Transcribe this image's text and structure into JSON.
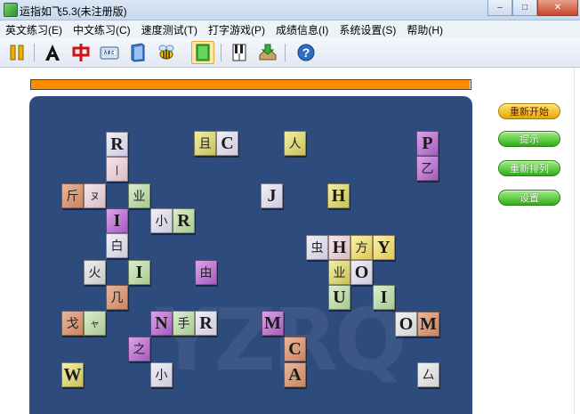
{
  "window": {
    "title": "运指如飞5.3(未注册版)",
    "minimize_symbol": "–",
    "maximize_symbol": "□",
    "close_symbol": "✕"
  },
  "menu": [
    "英文练习(E)",
    "中文练习(C)",
    "速度测试(T)",
    "打字游戏(P)",
    "成绩信息(I)",
    "系统设置(S)",
    "帮助(H)"
  ],
  "toolbar": {
    "icons": [
      "pause-icon",
      "english-letter-icon",
      "chinese-char-icon",
      "abc-keyboard-icon",
      "book-icon",
      "game-bee-icon",
      "green-book-icon",
      "piano-keys-icon",
      "download-tray-icon",
      "help-icon"
    ],
    "active_icon": "green-book-icon",
    "help_label": "?"
  },
  "progress": {
    "fraction": 0.998,
    "color": "#ff8c00"
  },
  "game": {
    "watermark": "YZRQ",
    "tiles": [
      {
        "ch": "R",
        "kind": "latin",
        "color": "lav"
      },
      {
        "ch": "|",
        "kind": "cjk",
        "color": "lpink"
      },
      {
        "ch": "且",
        "kind": "cjk",
        "color": "olive"
      },
      {
        "ch": "C",
        "kind": "latin",
        "color": "lav"
      },
      {
        "ch": "人",
        "kind": "cjk",
        "color": "olive"
      },
      {
        "ch": "P",
        "kind": "latin",
        "color": "purple"
      },
      {
        "ch": "乙",
        "kind": "cjk",
        "color": "purple"
      },
      {
        "ch": "斤",
        "kind": "cjk",
        "color": "salmon"
      },
      {
        "ch": "ヌ",
        "kind": "cjk",
        "color": "lpink"
      },
      {
        "ch": "业",
        "kind": "cjk",
        "color": "lgreen"
      },
      {
        "ch": "J",
        "kind": "latin",
        "color": "lav"
      },
      {
        "ch": "H",
        "kind": "latin",
        "color": "olive"
      },
      {
        "ch": "I",
        "kind": "latin",
        "color": "purple"
      },
      {
        "ch": "小",
        "kind": "cjk",
        "color": "lav"
      },
      {
        "ch": "R",
        "kind": "latin",
        "color": "lgreen"
      },
      {
        "ch": "白",
        "kind": "cjk",
        "color": "lav"
      },
      {
        "ch": "虫",
        "kind": "cjk",
        "color": "lav"
      },
      {
        "ch": "H",
        "kind": "latin",
        "color": "lpink"
      },
      {
        "ch": "方",
        "kind": "cjk",
        "color": "yellow"
      },
      {
        "ch": "Y",
        "kind": "latin",
        "color": "yellow"
      },
      {
        "ch": "火",
        "kind": "cjk",
        "color": "grey"
      },
      {
        "ch": "I",
        "kind": "latin",
        "color": "lgreen"
      },
      {
        "ch": "由",
        "kind": "cjk",
        "color": "purple"
      },
      {
        "ch": "业",
        "kind": "cjk",
        "color": "olive"
      },
      {
        "ch": "O",
        "kind": "latin",
        "color": "lav"
      },
      {
        "ch": "U",
        "kind": "latin",
        "color": "lgreen"
      },
      {
        "ch": "I",
        "kind": "latin",
        "color": "lgreen"
      },
      {
        "ch": "几",
        "kind": "cjk",
        "color": "salmon"
      },
      {
        "ch": "戈",
        "kind": "cjk",
        "color": "salmon"
      },
      {
        "ch": "ャ",
        "kind": "cjk",
        "color": "lgreen"
      },
      {
        "ch": "N",
        "kind": "latin",
        "color": "purple"
      },
      {
        "ch": "手",
        "kind": "cjk",
        "color": "lgreen"
      },
      {
        "ch": "R",
        "kind": "latin",
        "color": "lav"
      },
      {
        "ch": "M",
        "kind": "latin",
        "color": "purple"
      },
      {
        "ch": "O",
        "kind": "latin",
        "color": "lgrey2"
      },
      {
        "ch": "M",
        "kind": "latin",
        "color": "salmon"
      },
      {
        "ch": "之",
        "kind": "cjk",
        "color": "purple"
      },
      {
        "ch": "C",
        "kind": "latin",
        "color": "salmon"
      },
      {
        "ch": "W",
        "kind": "latin",
        "color": "olive"
      },
      {
        "ch": "小",
        "kind": "cjk",
        "color": "lav"
      },
      {
        "ch": "A",
        "kind": "latin",
        "color": "salmon"
      },
      {
        "ch": "厶",
        "kind": "cjk",
        "color": "lgrey2"
      }
    ]
  },
  "buttons": {
    "restart": "重新开始",
    "hint": "提示",
    "rearrange": "重新排列",
    "settings": "设置"
  }
}
